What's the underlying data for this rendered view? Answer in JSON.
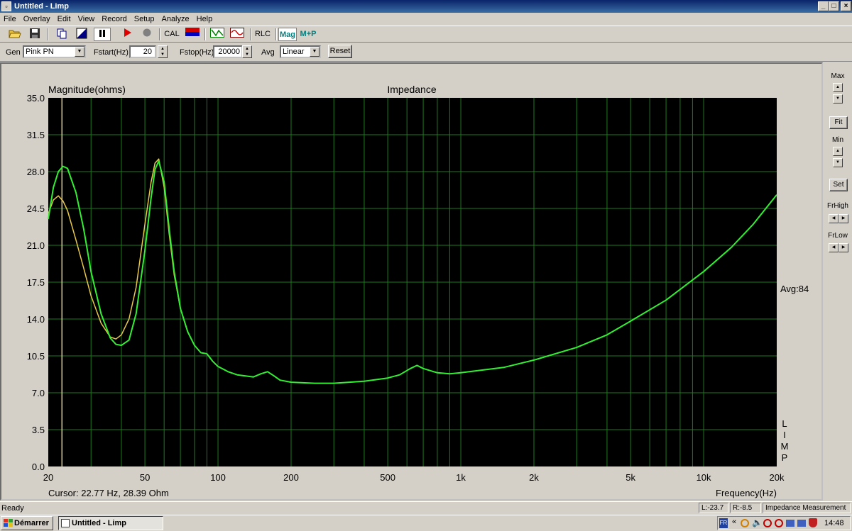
{
  "window": {
    "title": "Untitled - Limp",
    "min": "_",
    "max": "□",
    "close": "×"
  },
  "menu": [
    "File",
    "Overlay",
    "Edit",
    "View",
    "Record",
    "Setup",
    "Analyze",
    "Help"
  ],
  "toolbar": {
    "cal": "CAL",
    "rlc": "RLC",
    "mag": "Mag",
    "mp": "M+P"
  },
  "controls": {
    "gen_label": "Gen",
    "gen_value": "Pink PN",
    "fstart_label": "Fstart(Hz)",
    "fstart_value": "20",
    "fstop_label": "Fstop(Hz)",
    "fstop_value": "20000",
    "avg_label": "Avg",
    "avg_value": "Linear",
    "reset": "Reset"
  },
  "plot": {
    "ylabel_top": "Magnitude(ohms)",
    "title": "Impedance",
    "avg_label": "Avg:84",
    "cursor": "Cursor: 22.77 Hz, 28.39 Ohm",
    "xlabel": "Frequency(Hz)",
    "watermark": [
      "L",
      "I",
      "M",
      "P"
    ],
    "colors": {
      "bg": "#000000",
      "grid": "#1e7a1e",
      "green": "#33ee33",
      "yellow": "#e8c84a",
      "cursor": "#d8c890"
    }
  },
  "chart_data": {
    "type": "line",
    "title": "Impedance",
    "xlabel": "Frequency(Hz)",
    "ylabel": "Magnitude(ohms)",
    "xscale": "log",
    "xlim": [
      20,
      20000
    ],
    "ylim": [
      0,
      35
    ],
    "y_ticks": [
      "0.0",
      "3.5",
      "7.0",
      "10.5",
      "14.0",
      "17.5",
      "21.0",
      "24.5",
      "28.0",
      "31.5",
      "35.0"
    ],
    "x_ticks": [
      {
        "v": 20,
        "l": "20"
      },
      {
        "v": 50,
        "l": "50"
      },
      {
        "v": 100,
        "l": "100"
      },
      {
        "v": 200,
        "l": "200"
      },
      {
        "v": 500,
        "l": "500"
      },
      {
        "v": 1000,
        "l": "1k"
      },
      {
        "v": 2000,
        "l": "2k"
      },
      {
        "v": 5000,
        "l": "5k"
      },
      {
        "v": 10000,
        "l": "10k"
      },
      {
        "v": 20000,
        "l": "20k"
      }
    ],
    "cursor_x": 22.77,
    "series": [
      {
        "color": "#33ee33",
        "x": [
          20,
          21,
          22,
          23,
          24,
          26,
          28,
          30,
          33,
          36,
          38,
          40,
          43,
          46,
          50,
          53,
          55,
          57,
          60,
          63,
          66,
          70,
          75,
          80,
          85,
          90,
          95,
          100,
          110,
          120,
          140,
          150,
          160,
          170,
          180,
          200,
          250,
          300,
          400,
          500,
          560,
          620,
          660,
          700,
          800,
          900,
          1000,
          1500,
          2000,
          3000,
          4000,
          5000,
          7000,
          10000,
          13000,
          16000,
          20000
        ],
        "y": [
          23.5,
          26.5,
          28,
          28.5,
          28.3,
          26,
          22.5,
          18.5,
          14.5,
          12.2,
          11.6,
          11.5,
          12,
          14.5,
          20.5,
          25.5,
          28.2,
          29,
          27,
          22.5,
          18.5,
          15,
          12.8,
          11.5,
          10.8,
          10.7,
          10,
          9.5,
          9,
          8.7,
          8.5,
          8.8,
          9,
          8.6,
          8.2,
          8.0,
          7.9,
          7.9,
          8.1,
          8.4,
          8.7,
          9.3,
          9.6,
          9.3,
          8.9,
          8.8,
          8.9,
          9.4,
          10.1,
          11.3,
          12.5,
          13.8,
          15.8,
          18.5,
          20.8,
          23,
          25.8
        ]
      },
      {
        "color": "#e8c84a",
        "x": [
          20,
          21,
          22,
          23,
          24,
          26,
          28,
          30,
          33,
          36,
          38,
          40,
          43,
          46,
          50,
          53,
          55,
          57,
          60,
          63,
          66,
          70,
          75,
          80
        ],
        "y": [
          24,
          25.3,
          25.7,
          25.2,
          24.3,
          21.5,
          18.8,
          16.2,
          13.6,
          12.3,
          12.1,
          12.5,
          14,
          17,
          23,
          27,
          28.8,
          29.2,
          26.5,
          22,
          18.2,
          15,
          12.8,
          11.5
        ]
      }
    ]
  },
  "right_panel": {
    "max": "Max",
    "fit": "Fit",
    "min": "Min",
    "set": "Set",
    "frhigh": "FrHigh",
    "frlow": "FrLow"
  },
  "status": {
    "ready": "Ready",
    "l": "L:-23.7",
    "r": "R:-8.5",
    "mode": "Impedance Measurement"
  },
  "taskbar": {
    "start": "Démarrer",
    "task": "Untitled - Limp",
    "lang": "FR",
    "clock": "14:48"
  }
}
